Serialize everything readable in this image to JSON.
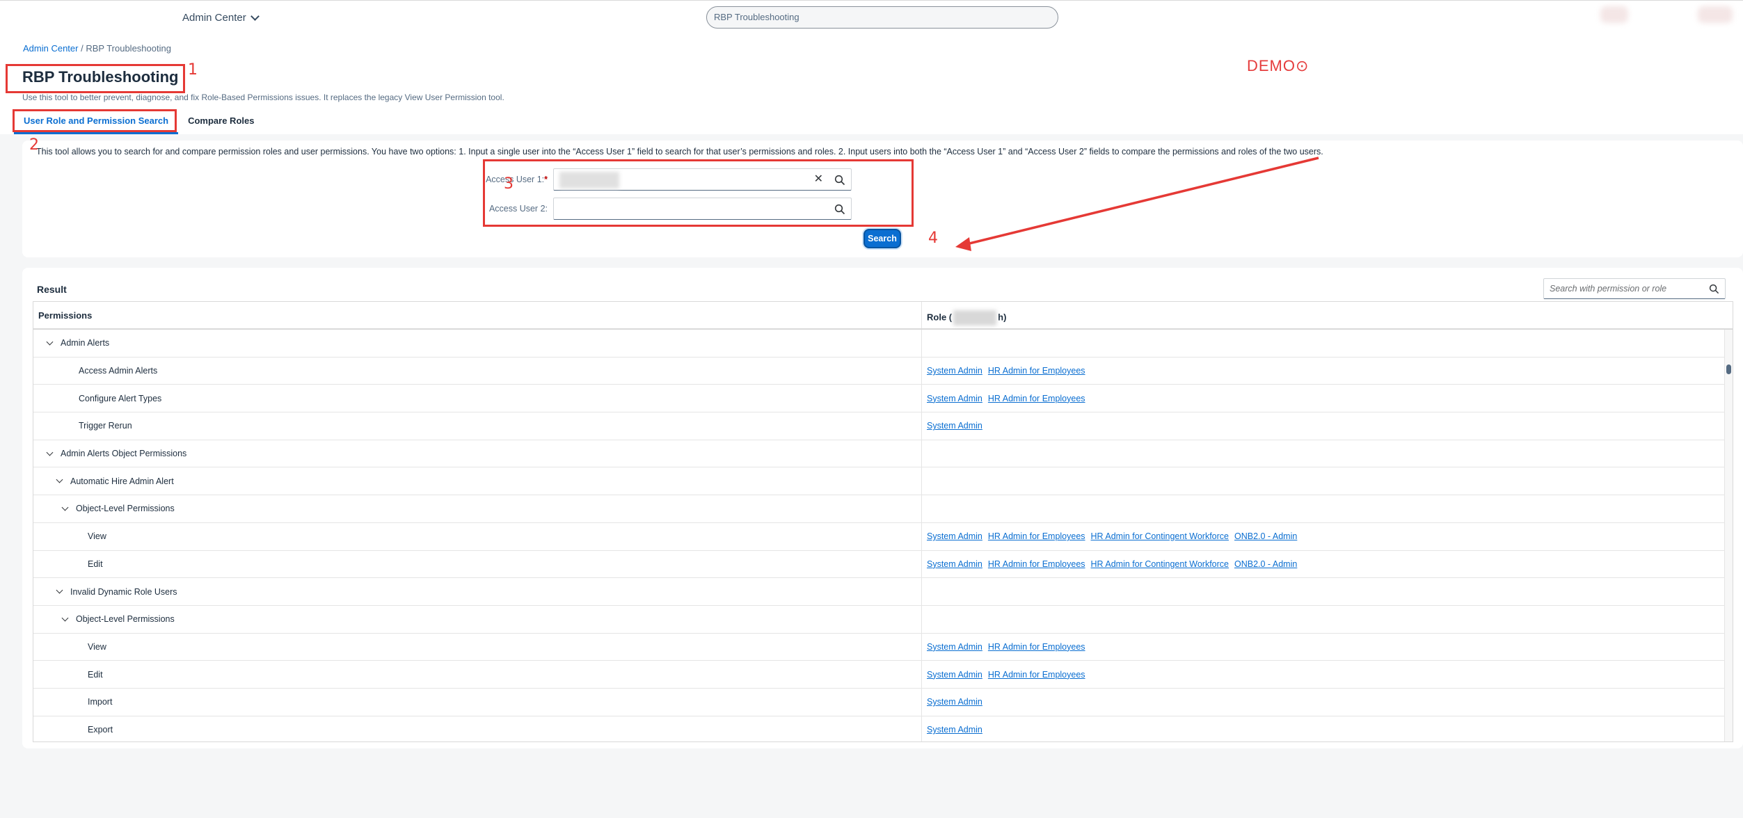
{
  "shell": {
    "app_title": "Admin Center",
    "search_value": "RBP Troubleshooting"
  },
  "breadcrumb": {
    "root": "Admin Center",
    "separator": " / ",
    "current": "RBP Troubleshooting"
  },
  "page": {
    "title": "RBP Troubleshooting",
    "description": "Use this tool to better prevent, diagnose, and fix Role-Based Permissions issues. It replaces the legacy View User Permission tool."
  },
  "watermark": "DEMO⊙",
  "tabs": [
    {
      "label": "User Role and Permission Search",
      "active": true
    },
    {
      "label": "Compare Roles",
      "active": false
    }
  ],
  "search_panel": {
    "intro": "This tool allows you to search for and compare permission roles and user permissions. You have two options: 1. Input a single user into the “Access User 1” field to search for that user’s permissions and roles. 2. Input users into both the “Access User 1” and “Access User 2” fields to compare the permissions and roles of the two users.",
    "user1_label": "Access User 1:",
    "user1_required": "*",
    "user2_label": "Access User 2:",
    "search_button": "Search"
  },
  "annotations": [
    "1",
    "2",
    "3",
    "4"
  ],
  "result": {
    "title": "Result",
    "search_placeholder": "Search with permission or role",
    "columns": {
      "permissions": "Permissions",
      "role_prefix": "Role (",
      "role_suffix": "h)"
    },
    "rows": [
      {
        "label": "Admin Alerts",
        "expandable": true,
        "roles": []
      },
      {
        "label": "Access Admin Alerts",
        "expandable": false,
        "roles": [
          "System Admin",
          "HR Admin for Employees"
        ]
      },
      {
        "label": "Configure Alert Types",
        "expandable": false,
        "roles": [
          "System Admin",
          "HR Admin for Employees"
        ]
      },
      {
        "label": "Trigger Rerun",
        "expandable": false,
        "roles": [
          "System Admin"
        ]
      },
      {
        "label": "Admin Alerts Object Permissions",
        "expandable": true,
        "roles": []
      },
      {
        "label": "Automatic Hire Admin Alert",
        "expandable": true,
        "roles": []
      },
      {
        "label": "Object-Level Permissions",
        "expandable": true,
        "roles": []
      },
      {
        "label": "View",
        "expandable": false,
        "roles": [
          "System Admin",
          "HR Admin for Employees",
          "HR Admin for Contingent Workforce",
          "ONB2.0 - Admin"
        ]
      },
      {
        "label": "Edit",
        "expandable": false,
        "roles": [
          "System Admin",
          "HR Admin for Employees",
          "HR Admin for Contingent Workforce",
          "ONB2.0 - Admin"
        ]
      },
      {
        "label": "Invalid Dynamic Role Users",
        "expandable": true,
        "roles": []
      },
      {
        "label": "Object-Level Permissions",
        "expandable": true,
        "roles": []
      },
      {
        "label": "View",
        "expandable": false,
        "roles": [
          "System Admin",
          "HR Admin for Employees"
        ]
      },
      {
        "label": "Edit",
        "expandable": false,
        "roles": [
          "System Admin",
          "HR Admin for Employees"
        ]
      },
      {
        "label": "Import",
        "expandable": false,
        "roles": [
          "System Admin"
        ]
      },
      {
        "label": "Export",
        "expandable": false,
        "roles": [
          "System Admin"
        ]
      }
    ]
  }
}
